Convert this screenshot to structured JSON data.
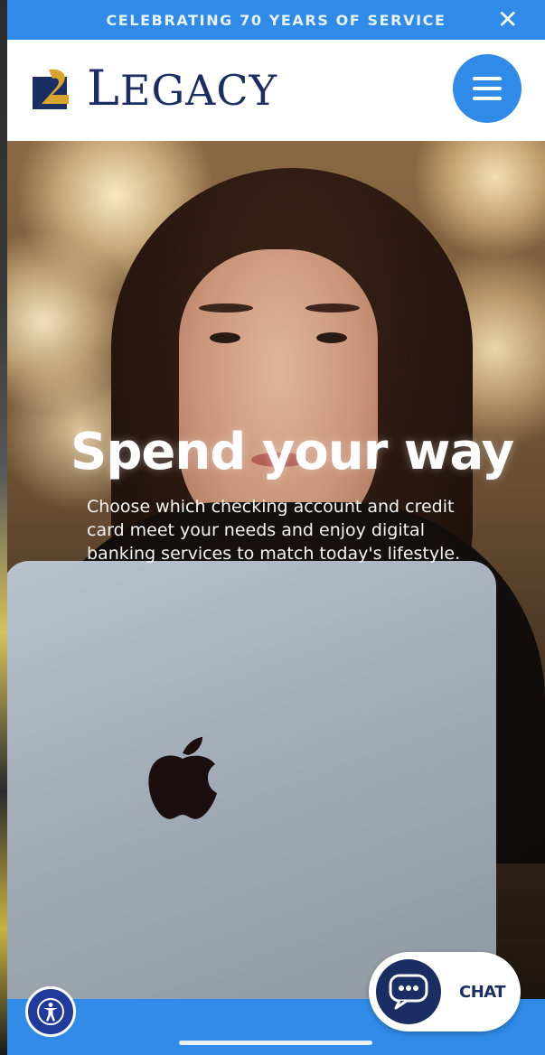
{
  "announcement": {
    "text": "CELEBRATING 70 YEARS OF SERVICE",
    "close_icon": "close-icon",
    "close_glyph": "✕"
  },
  "header": {
    "logo_initial": "L",
    "logo_rest": "EGACY",
    "menu_icon": "hamburger-menu-icon"
  },
  "hero": {
    "title": "Spend your way",
    "body": "Choose which checking account and credit card meet your needs and enjoy digital banking services to match today's lifestyle."
  },
  "chat": {
    "label": "CHAT",
    "icon": "chat-bubble-icon"
  },
  "accessibility": {
    "icon": "accessibility-icon"
  },
  "colors": {
    "brand_blue": "#2f8ae8",
    "navy": "#1b2e63",
    "gold": "#d6a52a"
  }
}
